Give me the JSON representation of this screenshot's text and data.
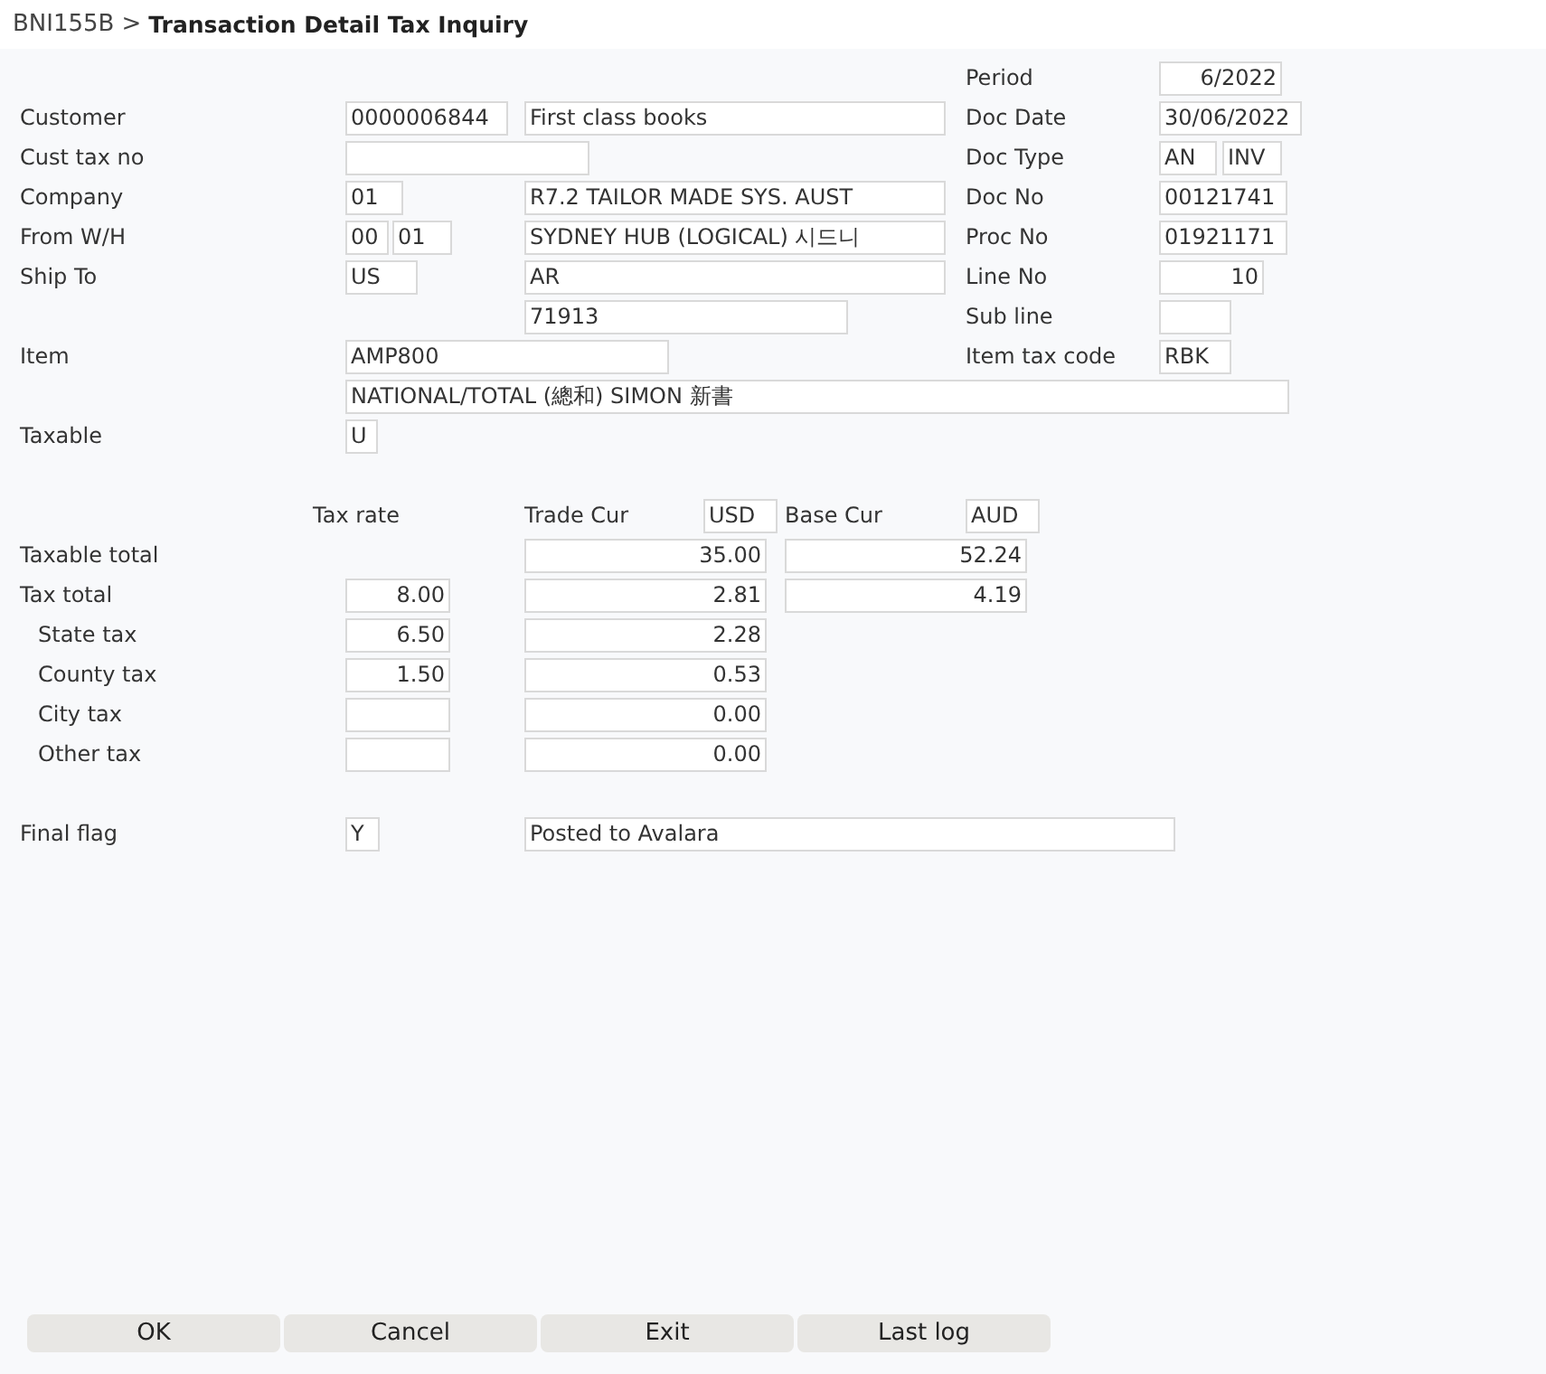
{
  "header": {
    "program": "BNI155B",
    "separator": ">",
    "title": "Transaction Detail Tax Inquiry"
  },
  "right_fields": [
    {
      "label": "Period",
      "values": [
        "6/2022"
      ]
    },
    {
      "label": "Doc Date",
      "values": [
        "30/06/2022"
      ]
    },
    {
      "label": "Doc Type",
      "values": [
        "AN",
        "INV"
      ]
    },
    {
      "label": "Doc No",
      "values": [
        "00121741"
      ]
    },
    {
      "label": "Proc No",
      "values": [
        "01921171"
      ]
    },
    {
      "label": "Line No",
      "values": [
        "10"
      ]
    },
    {
      "label": "Sub line",
      "values": [
        {
          "kind": "blank"
        }
      ]
    },
    {
      "label": "Item tax code",
      "values": [
        "RBK"
      ]
    }
  ],
  "left_fields": [
    {
      "label": "Customer",
      "values": [
        "0000006844",
        "First class books"
      ]
    },
    {
      "label": "Cust tax no",
      "values": [
        {
          "kind": "blank"
        }
      ]
    },
    {
      "label": "Company",
      "values": [
        "01",
        "R7.2 TAILOR MADE SYS. AUST"
      ]
    },
    {
      "label": "From W/H",
      "values": [
        "00",
        "01",
        "SYDNEY HUB (LOGICAL) 시드니"
      ]
    },
    {
      "label": "Ship To",
      "values": [
        "US",
        "AR"
      ]
    },
    {
      "values": [
        "71913"
      ]
    },
    {
      "label": "Item",
      "values": [
        "AMP800"
      ]
    },
    {
      "values": [
        "NATIONAL/TOTAL (總和) SIMON 新書"
      ]
    },
    {
      "label": "Taxable",
      "values": [
        "U"
      ]
    }
  ],
  "tax": {
    "rate_heading": "Tax rate",
    "trade_heading": "Trade Cur",
    "trade_currency": "USD",
    "base_heading": "Base Cur",
    "base_currency": "AUD",
    "rows": [
      {
        "label": "Taxable total",
        "trade": "35.00",
        "base": "52.24"
      },
      {
        "label": "Tax total",
        "rate": "8.00",
        "trade": "2.81",
        "base": "4.19",
        "children": [
          {
            "label": "State tax",
            "rate": "6.50",
            "trade": "2.28"
          },
          {
            "label": "County tax",
            "rate": "1.50",
            "trade": "0.53"
          },
          {
            "label": "City tax",
            "rate": {
              "kind": "blank"
            },
            "trade": "0.00"
          },
          {
            "label": "Other tax",
            "rate": {
              "kind": "blank"
            },
            "trade": "0.00"
          }
        ]
      }
    ]
  },
  "final": {
    "label": "Final flag",
    "flag": "Y",
    "status": "Posted to Avalara"
  },
  "buttons": [
    "OK",
    "Cancel",
    "Exit",
    "Last log"
  ]
}
